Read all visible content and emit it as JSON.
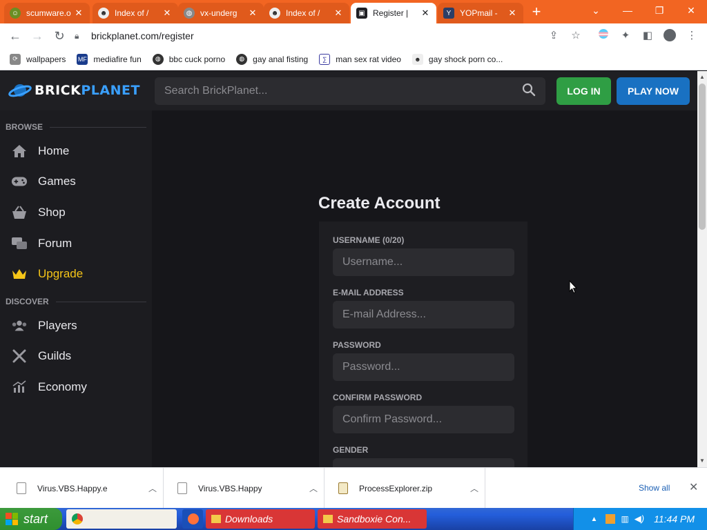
{
  "browser": {
    "tabs": [
      {
        "title": "scumware.o",
        "favicon": "smiley-icon"
      },
      {
        "title": "Index of /",
        "favicon": "troll-face-icon"
      },
      {
        "title": "vx-underg",
        "favicon": "globe-icon"
      },
      {
        "title": "Index of /",
        "favicon": "troll-face-icon"
      },
      {
        "title": "Register |",
        "favicon": "brickplanet-icon",
        "active": true
      },
      {
        "title": "YOPmail -",
        "favicon": "yopmail-icon"
      }
    ],
    "url": "brickplanet.com/register",
    "bookmarks": [
      {
        "label": "wallpapers"
      },
      {
        "label": "mediafire fun"
      },
      {
        "label": "bbc cuck porno"
      },
      {
        "label": "gay anal fisting"
      },
      {
        "label": "man sex rat video"
      },
      {
        "label": "gay shock porn co..."
      }
    ]
  },
  "site": {
    "brand_prefix": "BRICK",
    "brand_suffix": "PLANET",
    "search_placeholder": "Search BrickPlanet...",
    "login_label": "LOG IN",
    "play_label": "PLAY NOW",
    "sidebar": {
      "browse_header": "BROWSE",
      "browse_items": [
        {
          "label": "Home",
          "icon": "home-icon"
        },
        {
          "label": "Games",
          "icon": "gamepad-icon"
        },
        {
          "label": "Shop",
          "icon": "basket-icon"
        },
        {
          "label": "Forum",
          "icon": "chat-bubbles-icon"
        },
        {
          "label": "Upgrade",
          "icon": "crown-icon"
        }
      ],
      "discover_header": "DISCOVER",
      "discover_items": [
        {
          "label": "Players",
          "icon": "users-icon"
        },
        {
          "label": "Guilds",
          "icon": "crossed-swords-icon"
        },
        {
          "label": "Economy",
          "icon": "chart-icon"
        }
      ]
    },
    "form": {
      "title": "Create Account",
      "username_label": "USERNAME (0/20)",
      "username_placeholder": "Username...",
      "email_label": "E-MAIL ADDRESS",
      "email_placeholder": "E-mail Address...",
      "password_label": "PASSWORD",
      "password_placeholder": "Password...",
      "confirm_label": "CONFIRM PASSWORD",
      "confirm_placeholder": "Confirm Password...",
      "gender_label": "GENDER"
    }
  },
  "downloads": {
    "items": [
      {
        "name": "Virus.VBS.Happy.e"
      },
      {
        "name": "Virus.VBS.Happy"
      },
      {
        "name": "ProcessExplorer.zip"
      }
    ],
    "show_all": "Show all"
  },
  "taskbar": {
    "start": "start",
    "tasks": [
      {
        "label": "Downloads"
      },
      {
        "label": "Sandboxie Con..."
      }
    ],
    "clock": "11:44 PM"
  },
  "colors": {
    "chrome_accent": "#f26522",
    "login": "#2f9e44",
    "play": "#1971c2",
    "upgrade": "#f5c518",
    "brand_blue": "#3aa0ff"
  }
}
